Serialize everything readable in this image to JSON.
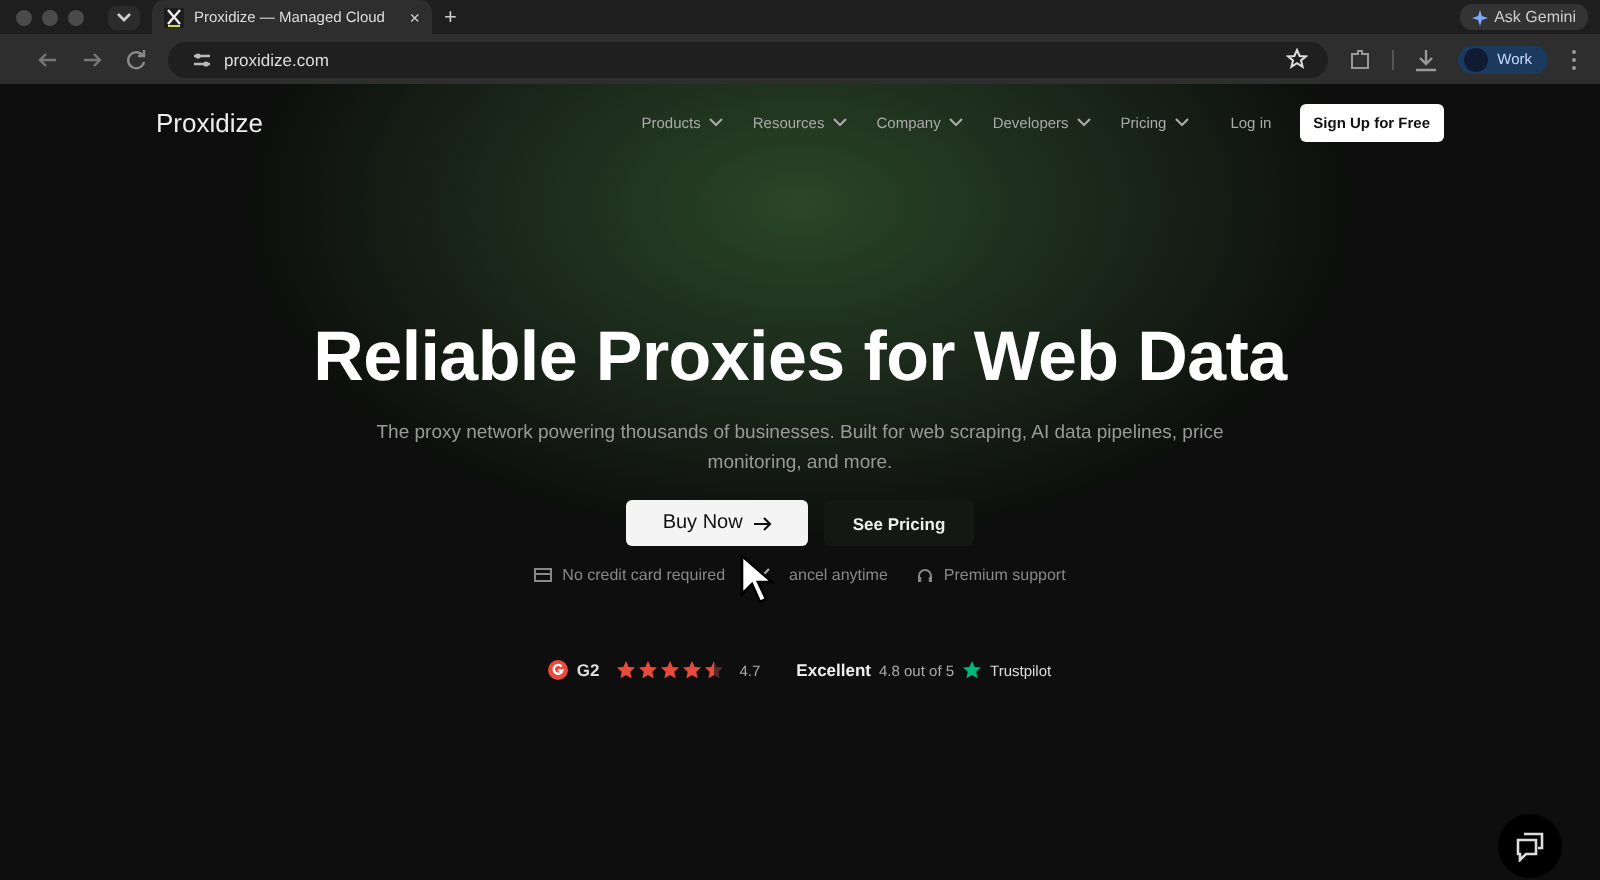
{
  "browser": {
    "tab": {
      "title": "Proxidize — Managed Cloud",
      "selected": true,
      "close": "×"
    },
    "new_tab": "+",
    "address": "proxidize.com",
    "ask_button": "Ask Gemini",
    "profile": "Work"
  },
  "nav": {
    "logo": "Proxidize",
    "items": [
      {
        "label": "Products"
      },
      {
        "label": "Resources"
      },
      {
        "label": "Company"
      },
      {
        "label": "Developers"
      },
      {
        "label": "Pricing"
      }
    ],
    "login": "Log in",
    "signup": "Sign Up for Free"
  },
  "hero": {
    "title": "Reliable Proxies for Web Data",
    "subtitle": "The proxy network powering thousands of businesses. Built for web scraping, AI data pipelines, price monitoring, and more.",
    "primary": "Buy Now",
    "secondary": "See Pricing",
    "features": [
      {
        "kind": "card",
        "label": "No credit card required"
      },
      {
        "kind": "cancel",
        "label": "ancel anytime"
      },
      {
        "kind": "support",
        "label": "Premium support"
      }
    ]
  },
  "ratings": {
    "g2": {
      "label": "G2",
      "stars": 4.5,
      "score": "4.7"
    },
    "trustpilot": {
      "word": "Excellent",
      "score": "4.8 out of 5",
      "brand": "Trustpilot"
    }
  }
}
